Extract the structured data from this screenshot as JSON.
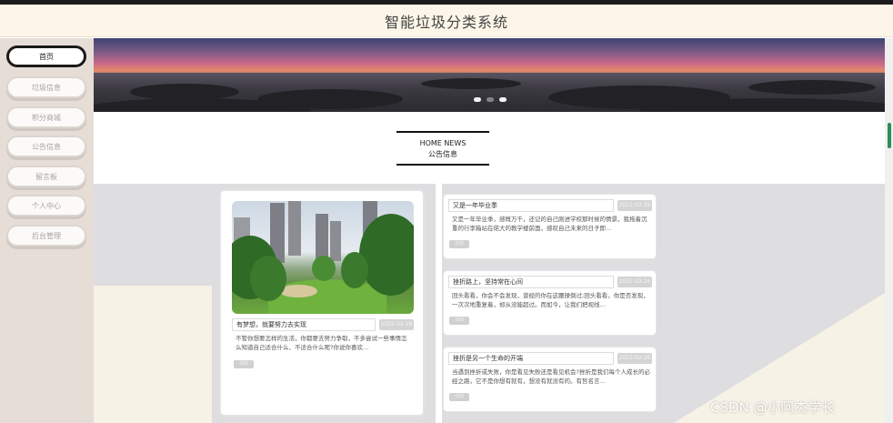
{
  "app": {
    "title": "智能垃圾分类系统"
  },
  "sidebar": {
    "items": [
      {
        "label": "首页",
        "active": true
      },
      {
        "label": "垃圾信息",
        "active": false
      },
      {
        "label": "积分商城",
        "active": false
      },
      {
        "label": "公告信息",
        "active": false
      },
      {
        "label": "留言板",
        "active": false
      },
      {
        "label": "个人中心",
        "active": false
      },
      {
        "label": "后台管理",
        "active": false
      }
    ]
  },
  "section": {
    "title_en": "HOME NEWS",
    "title_cn": "公告信息"
  },
  "featured": {
    "title": "有梦想，就要努力去实现",
    "date": "2022-02-26",
    "text": "不管你想要怎样的生活，你都要去努力争取，不多尝试一些事情怎么知道自己适合什么、不适合什么呢?你说你喜欢…",
    "button": "详情"
  },
  "news": [
    {
      "title": "又是一年毕业季",
      "date": "2022-02-26",
      "text": "又是一年毕业季，感慨万千，还记的自己刚进学校那时候的情景，我拖着沉重的行李箱站在偌大的教学楼前面，感叹自己未来的日子即…",
      "button": "详情"
    },
    {
      "title": "挫折路上，坚持常在心间",
      "date": "2022-02-26",
      "text": "回头看看，你会不会发现，曾经的你在这腰操倒过;回头看看，你是否发现，一次次地重复着，却从没能超过。而如今，让我们把视线…",
      "button": "详情"
    },
    {
      "title": "挫折是另一个生命的开端",
      "date": "2022-02-26",
      "text": "当遇到挫折或失败，你是看见失败还是看见机会?挫折是我们每个人成长的必经之路，它不是你想有就有，想没有就没有的。有哲名言…",
      "button": "详情"
    }
  ],
  "watermark": "CSDN @小阿杰学长",
  "colors": {
    "header_bg": "#fdf6e8",
    "sidebar_bg": "#e6ddd6",
    "content_bg": "#dedde0"
  },
  "banner": {
    "slides": 3,
    "current_slide": 1
  }
}
